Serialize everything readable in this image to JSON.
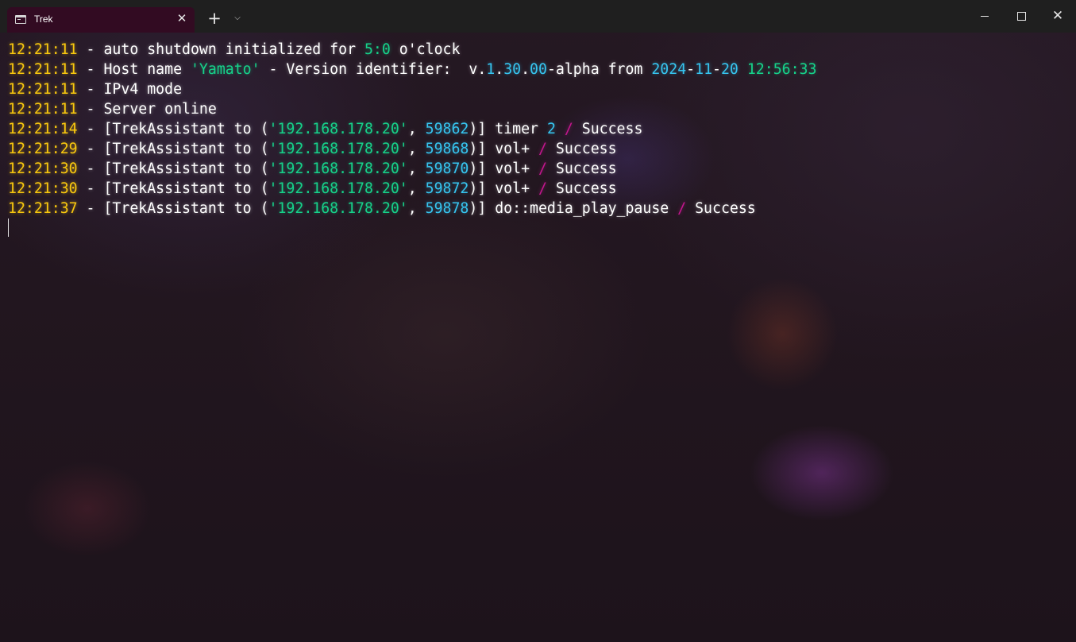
{
  "window": {
    "tab_title": "Trek",
    "tab_icon": "terminal-icon",
    "close_tab_glyph": "✕",
    "new_tab_glyph": "+",
    "dropdown_glyph": "⌵",
    "close_window_glyph": "✕"
  },
  "colors": {
    "timestamp": "#f9c80e",
    "string": "#16d28a",
    "number": "#36c5f0",
    "separator": "#c4168e",
    "text": "#ffffff",
    "tab_background": "#320b22",
    "titlebar_background": "#1f1f1f"
  },
  "terminal": {
    "lines": [
      {
        "time": "12:21:11",
        "dash": " - ",
        "text1": "auto shutdown initialized for ",
        "hour": "5:0",
        "text2": " o'clock"
      },
      {
        "time": "12:21:11",
        "dash": " - ",
        "text1": "Host name ",
        "host": "'Yamato'",
        "text2": " - Version identifier:  v.",
        "v1": "1",
        "dot1": ".",
        "v2": "30",
        "dot2": ".",
        "v3": "00",
        "text3": "-alpha from ",
        "y": "2024",
        "d1": "-",
        "mo": "11",
        "d2": "-",
        "day": "20",
        "sp": " ",
        "clock": "12:56:33"
      },
      {
        "time": "12:21:11",
        "dash": " - ",
        "text": "IPv4 mode"
      },
      {
        "time": "12:21:11",
        "dash": " - ",
        "text": "Server online"
      },
      {
        "time": "12:21:14",
        "dash": " - ",
        "pre": "[TrekAssistant to (",
        "ip": "'192.168.178.20'",
        "comma": ", ",
        "port": "59862",
        "close": ")] ",
        "cmd": "timer ",
        "arg": "2",
        "slash": " / ",
        "result": "Success"
      },
      {
        "time": "12:21:29",
        "dash": " - ",
        "pre": "[TrekAssistant to (",
        "ip": "'192.168.178.20'",
        "comma": ", ",
        "port": "59868",
        "close": ")] ",
        "cmd": "vol+",
        "slash": " / ",
        "result": "Success"
      },
      {
        "time": "12:21:30",
        "dash": " - ",
        "pre": "[TrekAssistant to (",
        "ip": "'192.168.178.20'",
        "comma": ", ",
        "port": "59870",
        "close": ")] ",
        "cmd": "vol+",
        "slash": " / ",
        "result": "Success"
      },
      {
        "time": "12:21:30",
        "dash": " - ",
        "pre": "[TrekAssistant to (",
        "ip": "'192.168.178.20'",
        "comma": ", ",
        "port": "59872",
        "close": ")] ",
        "cmd": "vol+",
        "slash": " / ",
        "result": "Success"
      },
      {
        "time": "12:21:37",
        "dash": " - ",
        "pre": "[TrekAssistant to (",
        "ip": "'192.168.178.20'",
        "comma": ", ",
        "port": "59878",
        "close": ")] ",
        "cmd": "do::media_play_pause",
        "slash": " / ",
        "result": "Success"
      }
    ]
  }
}
